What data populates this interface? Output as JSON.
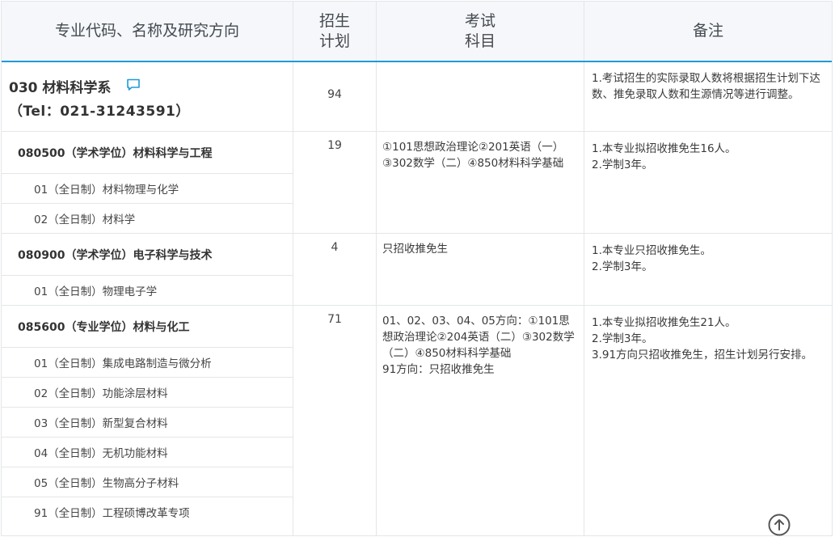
{
  "header": {
    "col1": "专业代码、名称及研究方向",
    "col2": "招生\n计划",
    "col3": "考试\n科目",
    "col4": "备注"
  },
  "department": {
    "name": "030 材料科学系",
    "tel": "（Tel：021-31243591）",
    "plan": "94",
    "note": "1.考试招生的实际录取人数将根据招生计划下达数、推免录取人数和生源情况等进行调整。"
  },
  "majors": [
    {
      "title": "080500（学术学位）材料科学与工程",
      "plan": "19",
      "exam": "①101思想政治理论②201英语（一）③302数学（二）④850材料科学基础",
      "notes": [
        "1.本专业拟招收推免生16人。",
        "2.学制3年。"
      ],
      "directions": [
        "01（全日制）材料物理与化学",
        "02（全日制）材料学"
      ]
    },
    {
      "title": "080900（学术学位）电子科学与技术",
      "plan": "4",
      "exam": "只招收推免生",
      "notes": [
        "1.本专业只招收推免生。",
        "2.学制3年。"
      ],
      "directions": [
        "01（全日制）物理电子学"
      ]
    },
    {
      "title": "085600（专业学位）材料与化工",
      "plan": "71",
      "exam": "01、02、03、04、05方向：①101思想政治理论②204英语（二）③302数学（二）④850材料科学基础",
      "exam2": "91方向：只招收推免生",
      "notes": [
        "1.本专业拟招收推免生21人。",
        "2.学制3年。",
        "3.91方向只招收推免生，招生计划另行安排。"
      ],
      "directions": [
        "01（全日制）集成电路制造与微分析",
        "02（全日制）功能涂层材料",
        "03（全日制）新型复合材料",
        "04（全日制）无机功能材料",
        "05（全日制）生物高分子材料",
        "91（全日制）工程硕博改革专项"
      ]
    }
  ],
  "icons": {
    "comment": "comment-icon",
    "scroll_top": "arrow-up-circle-icon"
  },
  "colors": {
    "accent": "#1e9bd6",
    "header_bg": "#f5f7fa",
    "border": "#e3e6ea"
  }
}
